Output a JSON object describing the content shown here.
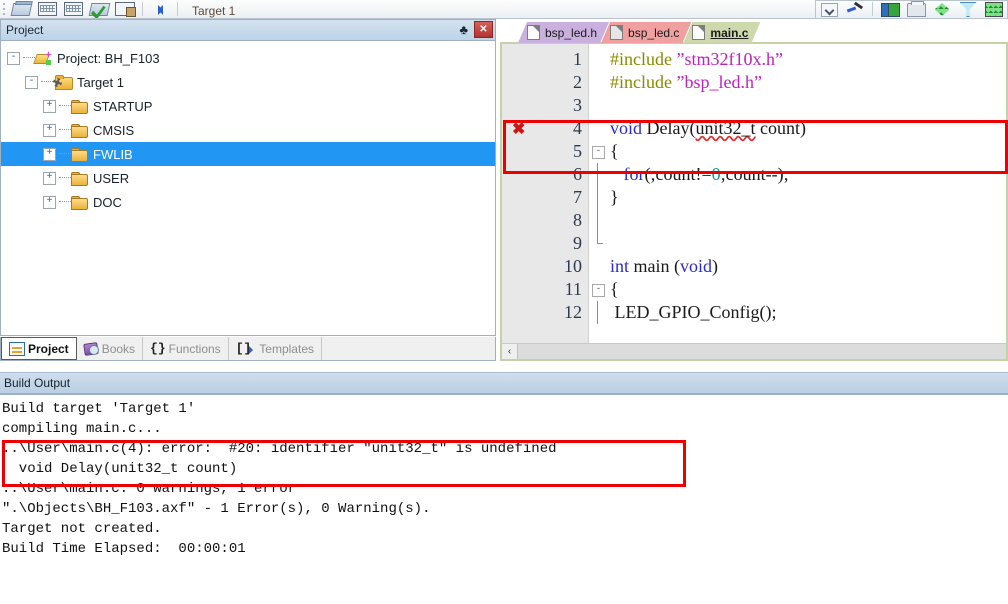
{
  "toolbar": {
    "target_label": "Target 1",
    "buttons": [
      {
        "name": "manage-components-icon",
        "icon": "books"
      },
      {
        "name": "build-target-icon",
        "icon": "grid"
      },
      {
        "name": "rebuild-all-icon",
        "icon": "grid"
      },
      {
        "name": "batch-build-icon",
        "icon": "greencheck"
      },
      {
        "name": "stop-build-icon",
        "icon": "keyx"
      },
      {
        "name": "manage-project-items-icon",
        "icon": "bluearrows"
      }
    ],
    "right_buttons": [
      {
        "name": "select-target-dropdown-icon",
        "icon": "chevdown"
      },
      {
        "name": "target-options-icon",
        "icon": "wrench"
      },
      {
        "name": "manage-project-icon",
        "icon": "panes"
      },
      {
        "name": "print-icon",
        "icon": "print"
      },
      {
        "name": "configure-diamond-icon",
        "icon": "diamond"
      },
      {
        "name": "filter-icon",
        "icon": "funnel"
      },
      {
        "name": "pack-installer-icon",
        "icon": "greenbox"
      }
    ]
  },
  "project_panel": {
    "title": "Project",
    "pin_glyph": "中",
    "close_glyph": "✕",
    "tree": [
      {
        "label": "Project: BH_F103",
        "icon": "project-icon",
        "twist": "-",
        "depth": 0,
        "selected": false
      },
      {
        "label": "Target 1",
        "icon": "target-icon",
        "twist": "-",
        "depth": 1,
        "selected": false
      },
      {
        "label": "STARTUP",
        "icon": "folder-icon",
        "twist": "+",
        "depth": 2,
        "selected": false
      },
      {
        "label": "CMSIS",
        "icon": "folder-icon",
        "twist": "+",
        "depth": 2,
        "selected": false
      },
      {
        "label": "FWLIB",
        "icon": "folder-icon",
        "twist": "+",
        "depth": 2,
        "selected": true
      },
      {
        "label": "USER",
        "icon": "folder-icon",
        "twist": "+",
        "depth": 2,
        "selected": false
      },
      {
        "label": "DOC",
        "icon": "folder-icon",
        "twist": "+",
        "depth": 2,
        "selected": false
      }
    ],
    "tabs": [
      {
        "label": "Project",
        "icon": "project-small-icon",
        "active": true
      },
      {
        "label": "Books",
        "icon": "books-small-icon",
        "active": false
      },
      {
        "label": "Functions",
        "icon": "braces-icon",
        "glyph": "{}",
        "active": false
      },
      {
        "label": "Templates",
        "icon": "templates-icon",
        "glyph": "[]",
        "active": false
      }
    ]
  },
  "editor": {
    "tabs": [
      {
        "label": "bsp_led.h",
        "active": false,
        "color": "#c9b0de",
        "icon": "file-icon"
      },
      {
        "label": "bsp_led.c",
        "active": false,
        "color": "#f0a0a0",
        "icon": "file-icon"
      },
      {
        "label": "main.c",
        "active": true,
        "color": "#cdd9ac",
        "icon": "file-icon"
      }
    ],
    "scroll_left_glyph": "‹",
    "lines": [
      {
        "num": "1",
        "error": false,
        "fold": "",
        "text": "#include ”stm32f10x.h”"
      },
      {
        "num": "2",
        "error": false,
        "fold": "",
        "text": "#include ”bsp_led.h”"
      },
      {
        "num": "3",
        "error": false,
        "fold": "",
        "text": ""
      },
      {
        "num": "4",
        "error": true,
        "fold": "",
        "text": "void Delay(unit32_t count)"
      },
      {
        "num": "5",
        "error": false,
        "fold": "-",
        "text": "{"
      },
      {
        "num": "6",
        "error": false,
        "fold": "",
        "text": "   for(;count!=0;count--);"
      },
      {
        "num": "7",
        "error": false,
        "fold": "",
        "text": "}"
      },
      {
        "num": "8",
        "error": false,
        "fold": "",
        "text": ""
      },
      {
        "num": "9",
        "error": false,
        "fold": "",
        "text": ""
      },
      {
        "num": "10",
        "error": false,
        "fold": "",
        "text": "int main (void)"
      },
      {
        "num": "11",
        "error": false,
        "fold": "-",
        "text": "{"
      },
      {
        "num": "12",
        "error": false,
        "fold": "",
        "text": " LED_GPIO_Config();"
      }
    ],
    "error_marker_glyph": "✖"
  },
  "build_output": {
    "title": "Build Output",
    "lines": [
      "Build target 'Target 1'",
      "compiling main.c...",
      "..\\User\\main.c(4): error:  #20: identifier \"unit32_t\" is undefined",
      "  void Delay(unit32_t count)",
      "..\\User\\main.c: 0 warnings, 1 error",
      "\".\\Objects\\BH_F103.axf\" - 1 Error(s), 0 Warning(s).",
      "Target not created.",
      "Build Time Elapsed:  00:00:01"
    ]
  },
  "annotations": {
    "highlight_color": "#ee0000",
    "code_box_lines": "4-5",
    "build_box_lines": "3-4"
  }
}
